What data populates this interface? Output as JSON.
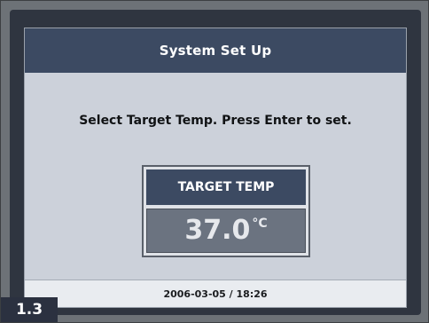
{
  "screen": {
    "header_title": "System Set Up",
    "instruction": "Select Target Temp. Press Enter to set.",
    "target_temp": {
      "label": "TARGET TEMP",
      "value": "37.0",
      "unit": "°C"
    },
    "status_datetime": "2006-03-05 / 18:26"
  },
  "figure_label": "1.3",
  "colors": {
    "header_bg": "#3c4a62",
    "screen_bg": "#ccd1da",
    "value_box_bg": "#6b7380",
    "frame": "#2f3540"
  }
}
